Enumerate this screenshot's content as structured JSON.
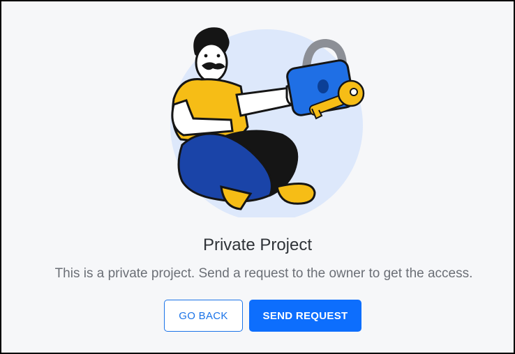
{
  "dialog": {
    "title": "Private Project",
    "description": "This is a private project. Send a request to the owner to get the access.",
    "buttons": {
      "go_back_label": "GO BACK",
      "send_request_label": "SEND REQUEST"
    },
    "illustration": {
      "icon_names": [
        "person-illustration",
        "padlock-icon",
        "key-icon"
      ]
    }
  },
  "colors": {
    "accent": "#0d6efd",
    "outline_button_text": "#1a73e8",
    "title": "#2f3338",
    "description": "#6b6f76",
    "background": "#f6f7f9",
    "circle": "#dde8fb"
  }
}
